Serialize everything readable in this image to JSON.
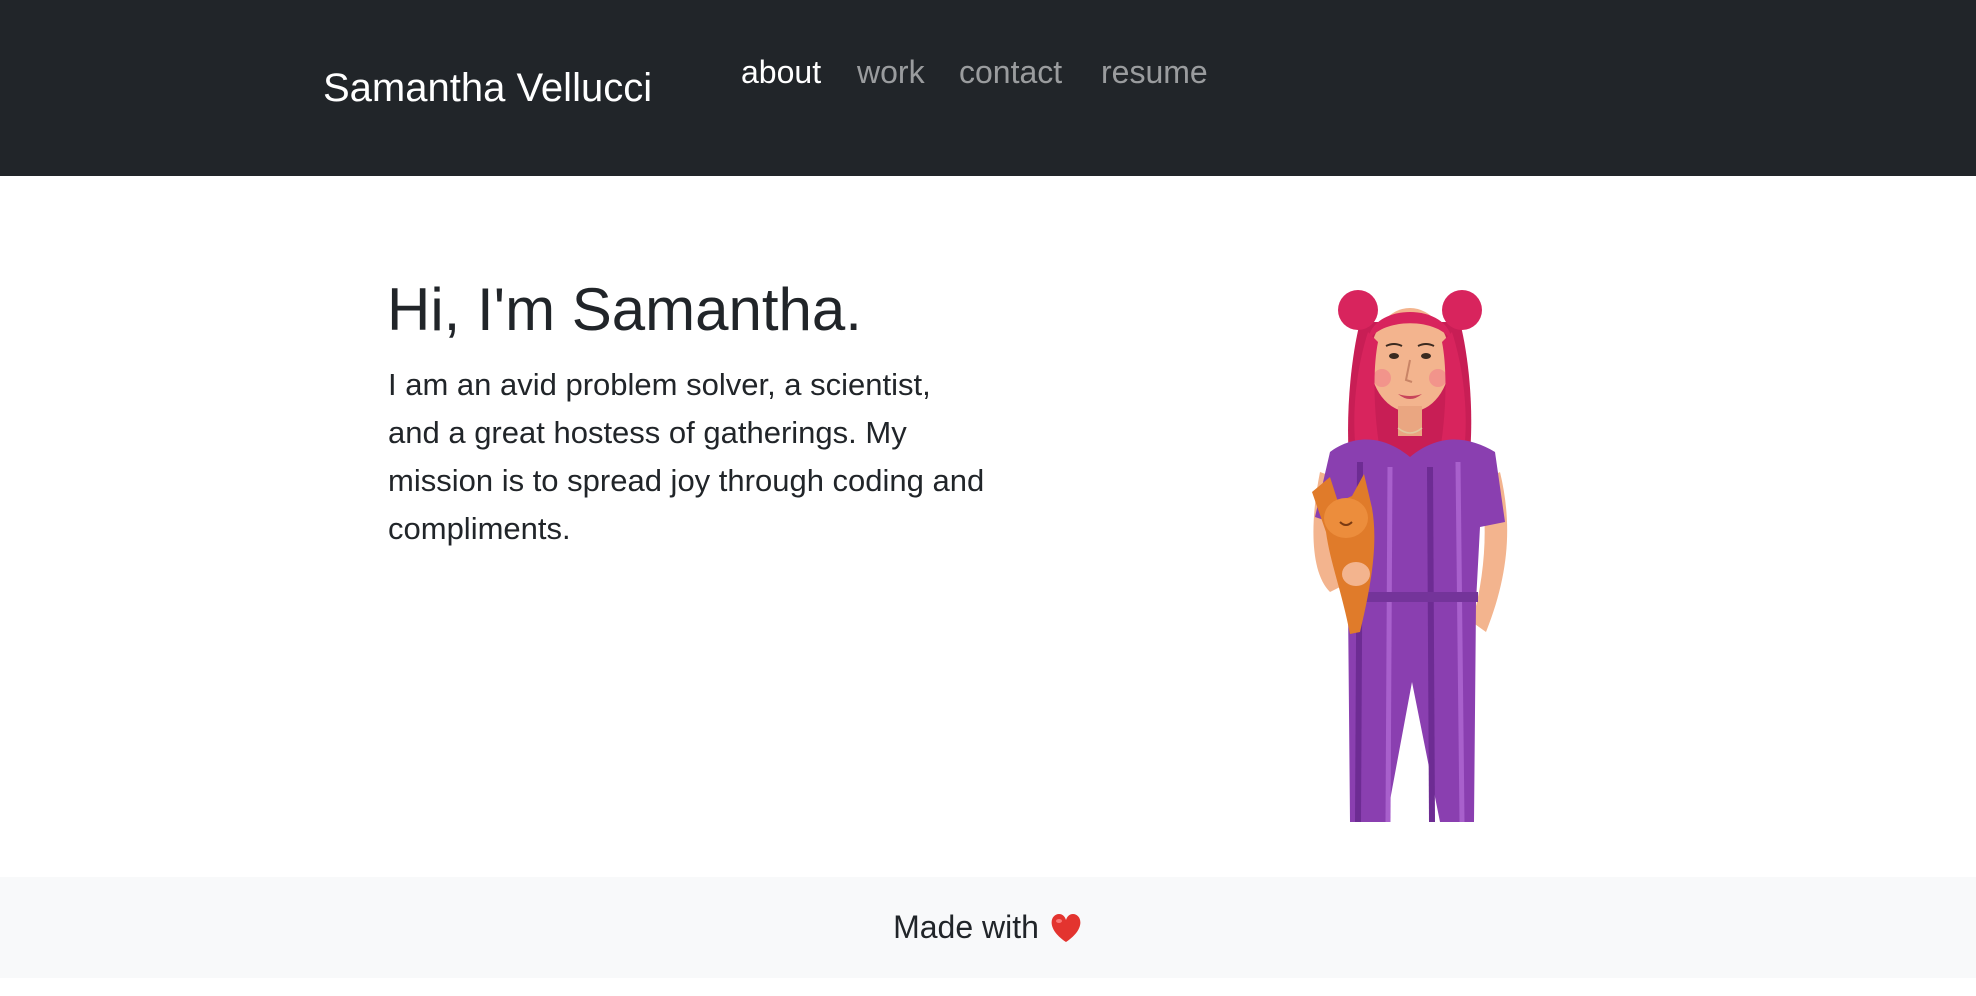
{
  "navbar": {
    "brand": "Samantha Vellucci",
    "links": [
      {
        "label": "about",
        "active": true
      },
      {
        "label": "work",
        "active": false
      },
      {
        "label": "contact",
        "active": false
      },
      {
        "label": "resume",
        "active": false
      }
    ]
  },
  "hero": {
    "title": "Hi, I'm Samantha.",
    "text": "I am an avid problem solver, a scientist, and a great hostess of gatherings. My mission is to spread joy through coding and compliments."
  },
  "footer": {
    "text": "Made with",
    "icon": "heart-icon"
  },
  "colors": {
    "navbar_bg": "#212529",
    "footer_bg": "#f8f9fa",
    "hair": "#d8245d",
    "jumpsuit": "#8a3fb0",
    "dog": "#e07b2a",
    "heart": "#e3342f"
  }
}
